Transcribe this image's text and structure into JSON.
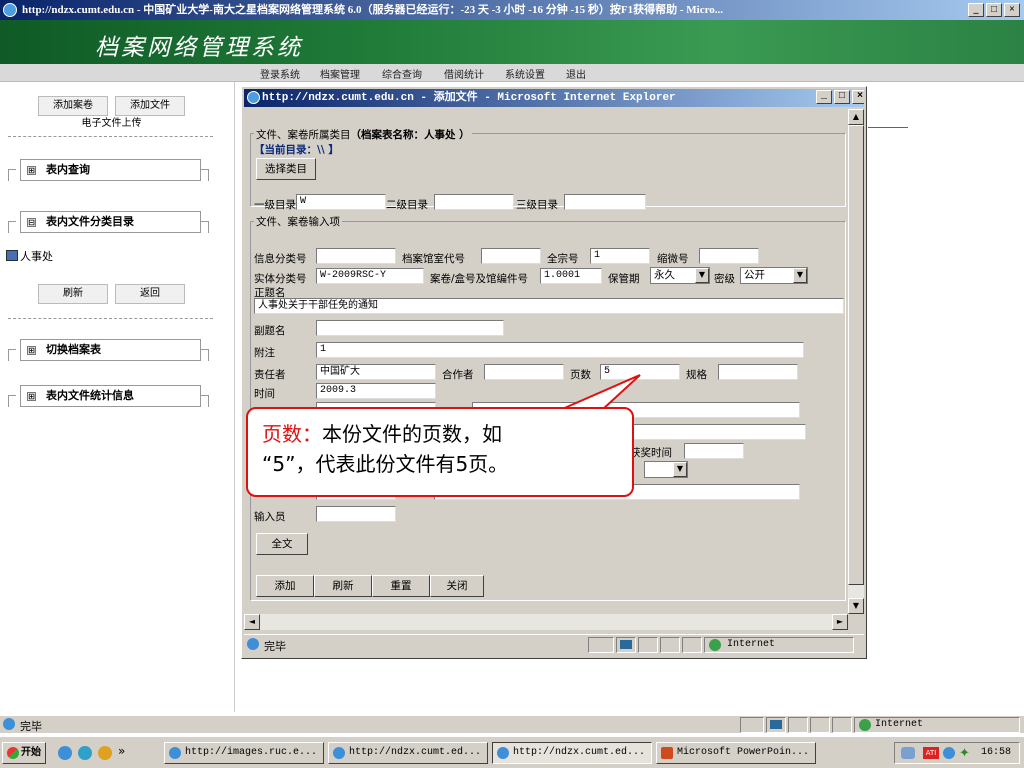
{
  "window": {
    "title": "http://ndzx.cumt.edu.cn - 中国矿业大学-南大之星档案网络管理系统 6.0（服务器已经运行：-23 天 -3 小时 -16 分钟 -15 秒）按F1获得帮助 - Micro..."
  },
  "banner": {
    "title": "档案网络管理系统"
  },
  "nav": {
    "items": [
      "登录系统",
      "档案管理",
      "综合查询",
      "借阅统计",
      "系统设置",
      "退出"
    ]
  },
  "left": {
    "add_volume": "添加案卷",
    "add_file": "添加文件",
    "upload_file": "电子文件上传",
    "sec_query": "表内查询",
    "sec_catalog": "表内文件分类目录",
    "tree_item": "人事处",
    "refresh": "刷新",
    "back": "返回",
    "sec_switch": "切换档案表",
    "sec_stats": "表内文件统计信息",
    "plus": "⊞",
    "minus": "⊟"
  },
  "popup": {
    "title": "http://ndzx.cumt.edu.cn - 添加文件 - Microsoft Internet Explorer",
    "fs1_legend": "文件、案卷所属类目",
    "table_name": "（档案表名称：人事处 ）",
    "current_dir": "【当前目录：\\\\ 】",
    "choose_cat": "选择类目",
    "lvl1_label": "一级目录",
    "lvl1_value": "W",
    "lvl2_label": "二级目录",
    "lvl3_label": "三级目录",
    "fs2_legend": "文件、案卷输入项",
    "info_cat": "信息分类号",
    "room_code": "档案馆室代号",
    "fonds_no": "全宗号",
    "fonds_value": "1",
    "micro_no": "缩微号",
    "entity_cat": "实体分类号",
    "entity_value": "W-2009RSC-Y",
    "box_no": "案卷/盒号及馆编件号",
    "box_value": "1.0001",
    "period": "保管期",
    "period_value": "永久",
    "secret": "密级",
    "secret_value": "公开",
    "main_title_label": "正题名",
    "main_title_value": "人事处关于干部任免的通知",
    "sub_title": "副题名",
    "note": "附注",
    "note_value": "1",
    "responsible": "责任者",
    "responsible_value": "中国矿大",
    "coauthor": "合作者",
    "pages": "页数",
    "pages_value": "5",
    "spec": "规格",
    "time": "时间",
    "time_value": "2009.3",
    "award_time": "获奖时间",
    "entry_person": "输入员",
    "fulltext_btn": "全文",
    "add_btn": "添加",
    "refresh_btn": "刷新",
    "reset_btn": "重置",
    "close_btn": "关闭",
    "status_done": "完毕",
    "status_zone": "Internet"
  },
  "callout": {
    "label": "页数：",
    "text1": "本份文件的页数，如",
    "text2": "“5”，代表此份文件有5页。"
  },
  "statusbar": {
    "done": "完毕",
    "zone": "Internet"
  },
  "taskbar": {
    "start": "开始",
    "more": "»",
    "tasks": [
      "http://images.ruc.e...",
      "http://ndzx.cumt.ed...",
      "http://ndzx.cumt.ed...",
      "Microsoft PowerPoin..."
    ],
    "clock": "16:58"
  }
}
